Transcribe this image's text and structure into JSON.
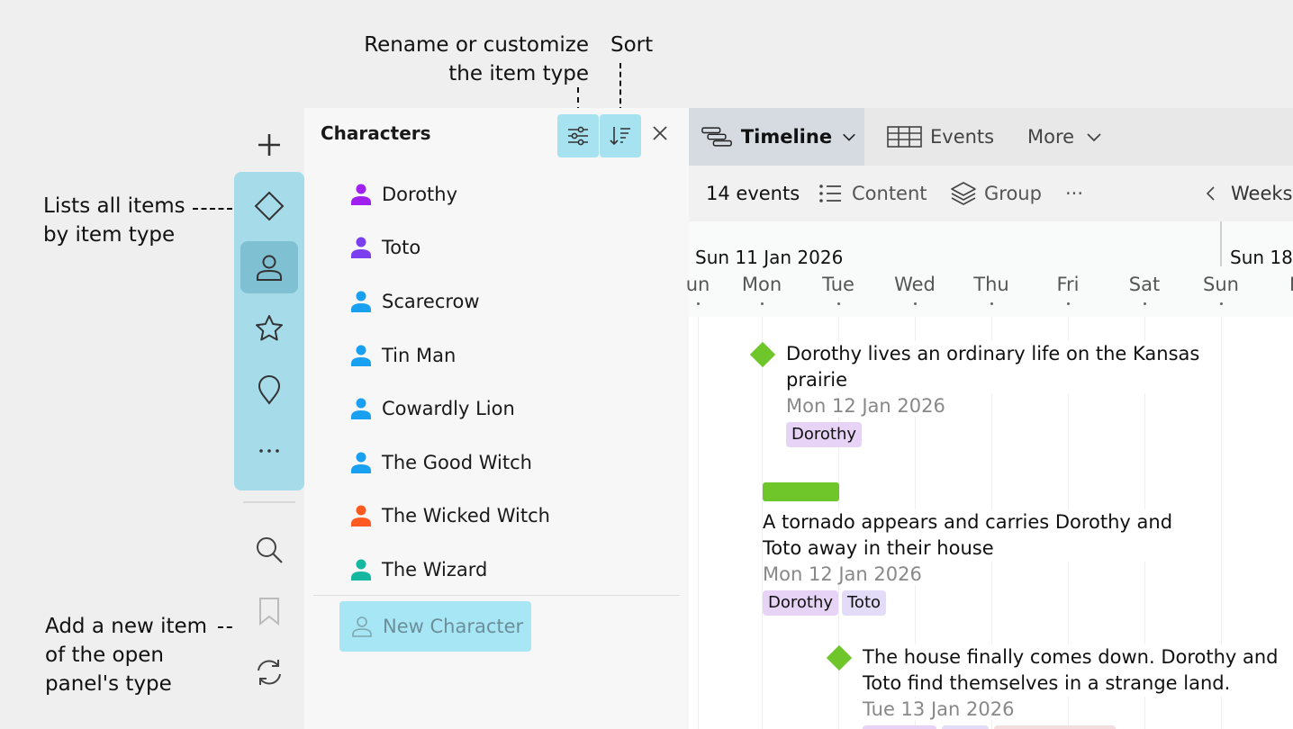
{
  "annotations": {
    "rename": [
      "Rename or customize",
      "the item type"
    ],
    "sort": "Sort",
    "lists": [
      "Lists all items",
      "by item type"
    ],
    "add": [
      "Add a new item",
      "of the open",
      "panel's type"
    ]
  },
  "panel": {
    "title": "Characters",
    "characters": [
      {
        "name": "Dorothy",
        "color": "#a020f0"
      },
      {
        "name": "Toto",
        "color": "#7b3ff0"
      },
      {
        "name": "Scarecrow",
        "color": "#1aa0f0"
      },
      {
        "name": "Tin Man",
        "color": "#1aa0f0"
      },
      {
        "name": "Cowardly Lion",
        "color": "#1aa0f0"
      },
      {
        "name": "The Good Witch",
        "color": "#1aa0f0"
      },
      {
        "name": "The Wicked Witch",
        "color": "#ff5a1f"
      },
      {
        "name": "The Wizard",
        "color": "#14b8a0"
      }
    ],
    "new_item": "New Character"
  },
  "tabs": {
    "timeline": "Timeline",
    "events": "Events",
    "more": "More"
  },
  "subbar": {
    "count": "14 events",
    "content": "Content",
    "group": "Group",
    "overflow": "···",
    "zoom": "Weeks"
  },
  "timeline": {
    "week1": "Sun 11 Jan 2026",
    "week2": "Sun 18",
    "days": [
      "un",
      "Mon",
      "Tue",
      "Wed",
      "Thu",
      "Fri",
      "Sat",
      "Sun",
      "M"
    ],
    "events": [
      {
        "title_lines": [
          "Dorothy lives an ordinary life on the Kansas",
          "prairie"
        ],
        "date": "Mon 12 Jan 2026",
        "tags": [
          "Dorothy"
        ]
      },
      {
        "title_lines": [
          "A tornado appears and carries Dorothy and",
          "Toto away in their house"
        ],
        "date": "Mon 12 Jan 2026",
        "tags": [
          "Dorothy",
          "Toto"
        ]
      },
      {
        "title_lines": [
          "The house finally comes down. Dorothy and",
          "Toto find themselves in a strange land."
        ],
        "date": "Tue 13 Jan 2026",
        "tags": []
      }
    ]
  },
  "colors": {
    "accent": "#a6dcea",
    "milestone": "#6ec62a",
    "tag_purple": "#e6d3f5",
    "tag_lavender": "#e2dcf8"
  }
}
